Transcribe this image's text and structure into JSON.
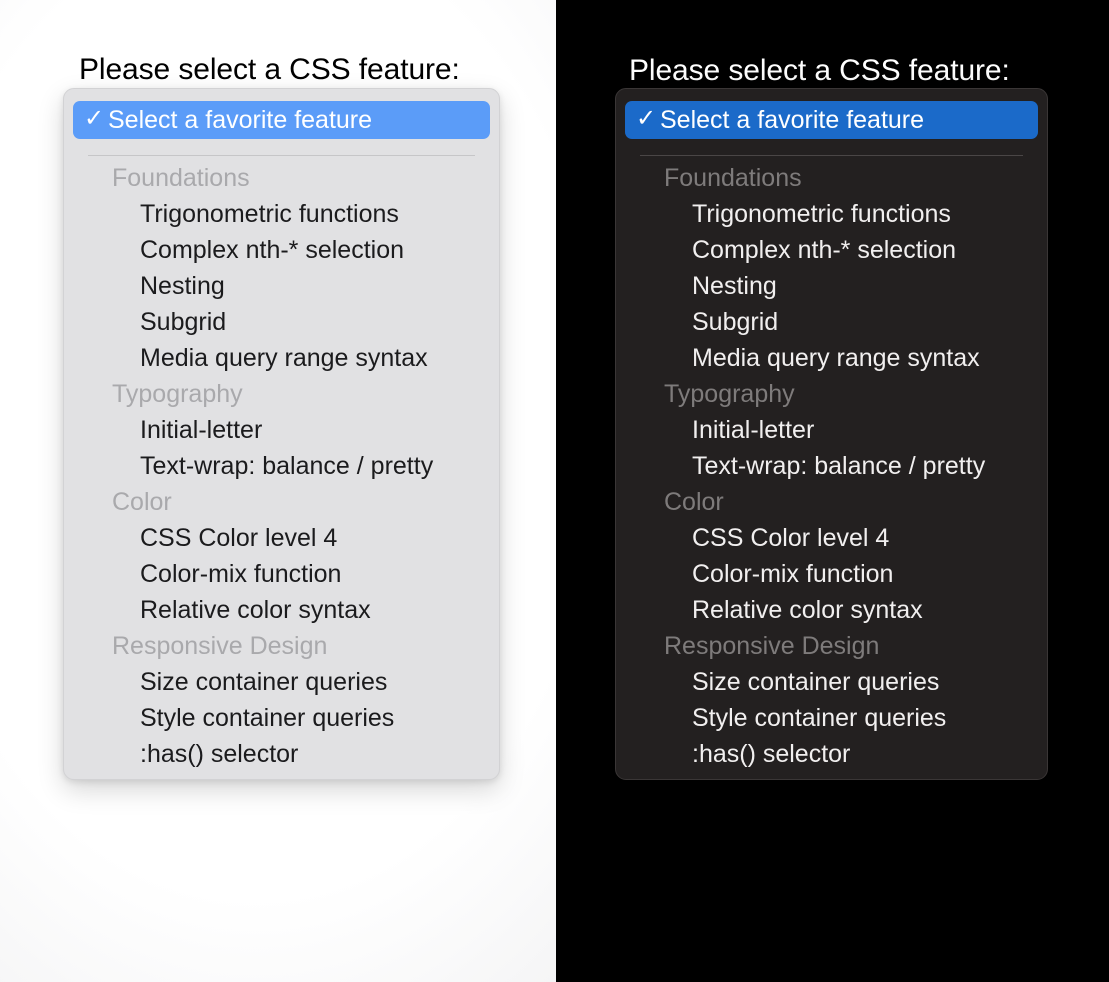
{
  "light": {
    "prompt": "Please select a CSS feature:",
    "selected": {
      "check_icon": "✓",
      "label": "Select a favorite feature"
    }
  },
  "dark": {
    "prompt": "Please select a CSS feature:",
    "selected": {
      "check_icon": "✓",
      "label": "Select a favorite feature"
    }
  },
  "groups": [
    {
      "label": "Foundations",
      "options": [
        "Trigonometric functions",
        "Complex nth-* selection",
        "Nesting",
        "Subgrid",
        "Media query range syntax"
      ]
    },
    {
      "label": "Typography",
      "options": [
        "Initial-letter",
        "Text-wrap: balance / pretty"
      ]
    },
    {
      "label": "Color",
      "options": [
        "CSS Color level 4",
        "Color-mix function",
        "Relative color syntax"
      ]
    },
    {
      "label": "Responsive Design",
      "options": [
        "Size container queries",
        "Style container queries",
        ":has() selector"
      ]
    }
  ],
  "colors": {
    "light_panel_bg": "#e1e1e3",
    "light_highlight": "#5b9cf8",
    "light_text": "#1b1b1d",
    "light_group_text": "#a9a9ac",
    "dark_page_bg": "#000000",
    "dark_panel_bg": "#232020",
    "dark_highlight": "#1b6ac9",
    "dark_text": "#f1efef",
    "dark_group_text": "#7e7b7b",
    "selected_text": "#ffffff"
  }
}
